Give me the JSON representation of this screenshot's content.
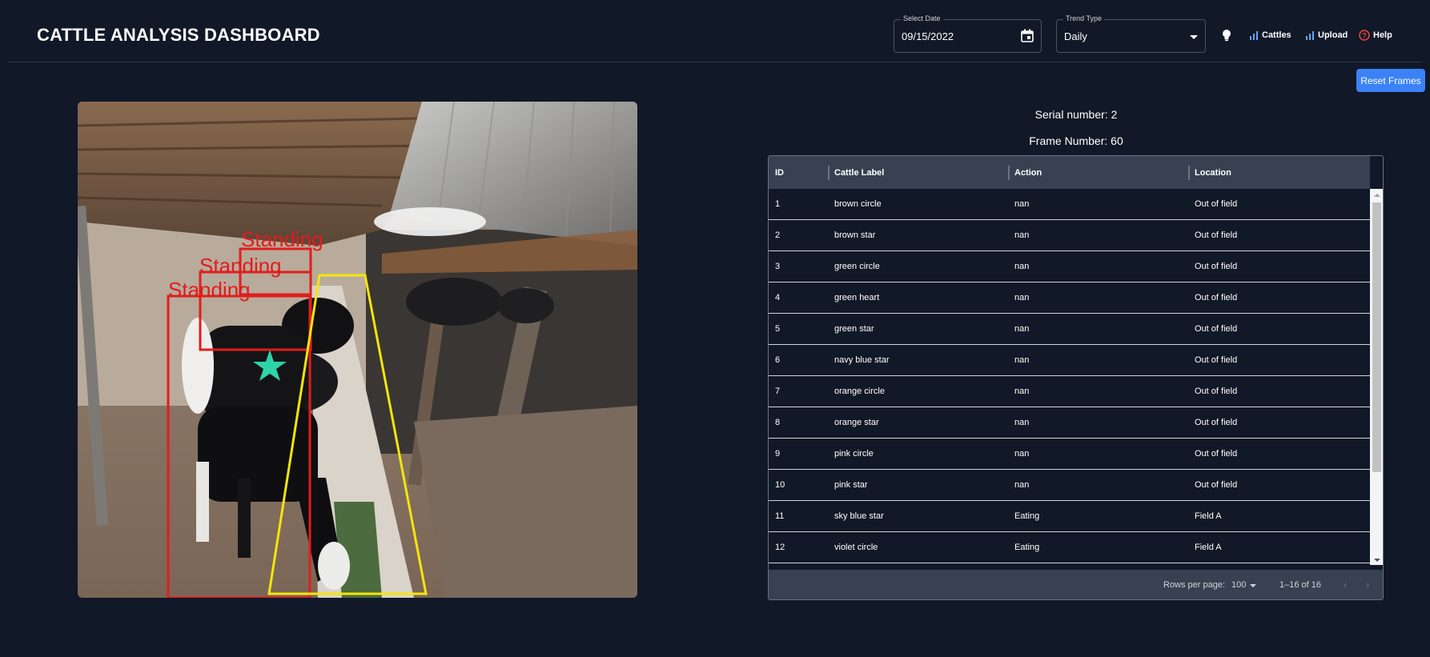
{
  "header": {
    "title": "CATTLE ANALYSIS DASHBOARD",
    "date_label": "Select Date",
    "date_value": "09/15/2022",
    "trend_label": "Trend Type",
    "trend_value": "Daily",
    "nav": {
      "cattles": "Cattles",
      "upload": "Upload",
      "help": "Help"
    }
  },
  "reset_button": "Reset Frames",
  "frame": {
    "detections": [
      {
        "label": "Standing"
      },
      {
        "label": "Standing"
      },
      {
        "label": "Standing"
      }
    ]
  },
  "info": {
    "serial": "Serial number: 2",
    "frame": "Frame Number: 60"
  },
  "table": {
    "columns": [
      "ID",
      "Cattle Label",
      "Action",
      "Location"
    ],
    "rows": [
      [
        "1",
        "brown circle",
        "nan",
        "Out of field"
      ],
      [
        "2",
        "brown star",
        "nan",
        "Out of field"
      ],
      [
        "3",
        "green circle",
        "nan",
        "Out of field"
      ],
      [
        "4",
        "green heart",
        "nan",
        "Out of field"
      ],
      [
        "5",
        "green star",
        "nan",
        "Out of field"
      ],
      [
        "6",
        "navy blue star",
        "nan",
        "Out of field"
      ],
      [
        "7",
        "orange circle",
        "nan",
        "Out of field"
      ],
      [
        "8",
        "orange star",
        "nan",
        "Out of field"
      ],
      [
        "9",
        "pink circle",
        "nan",
        "Out of field"
      ],
      [
        "10",
        "pink star",
        "nan",
        "Out of field"
      ],
      [
        "11",
        "sky blue star",
        "Eating",
        "Field A"
      ],
      [
        "12",
        "violet circle",
        "Eating",
        "Field A"
      ]
    ],
    "footer": {
      "rows_per_page_label": "Rows per page:",
      "rows_per_page_value": "100",
      "range": "1–16 of 16"
    }
  },
  "colors": {
    "background": "#111827",
    "accent": "#3b82f6",
    "header_row": "#374151",
    "bbox": "#e11d1d",
    "zone": "#f5e50b",
    "marker": "#2dd4a8"
  }
}
